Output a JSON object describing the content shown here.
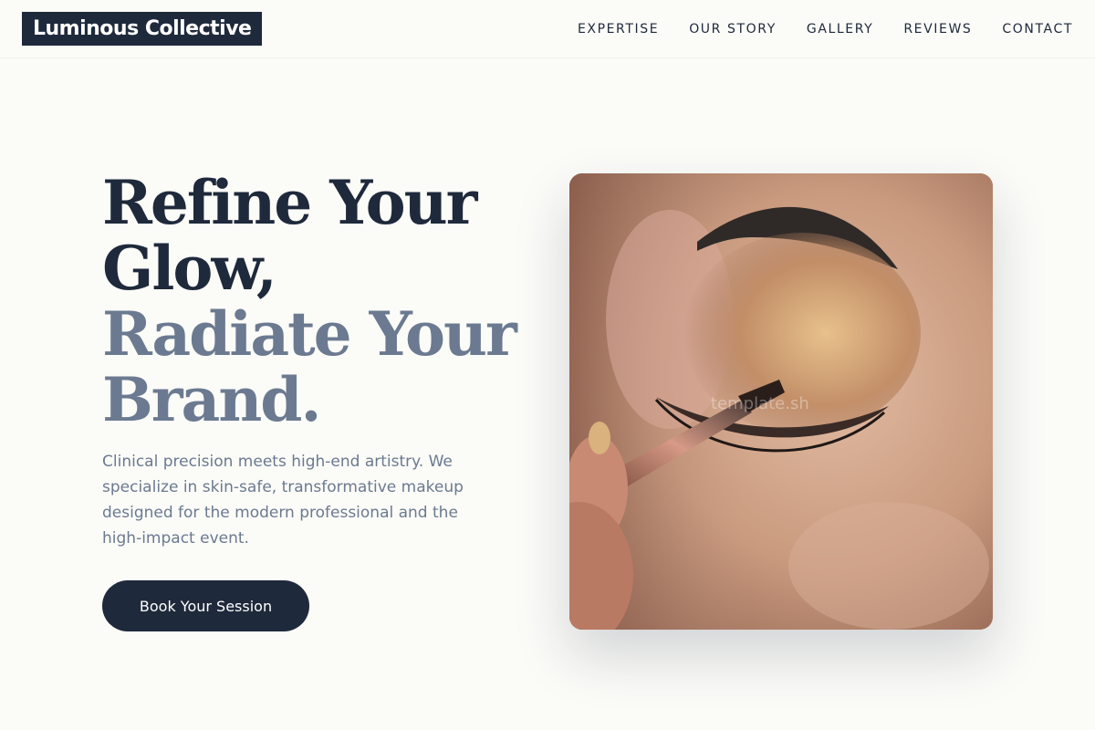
{
  "brand": {
    "name": "Luminous Collective"
  },
  "nav": {
    "items": [
      {
        "label": "EXPERTISE"
      },
      {
        "label": "OUR STORY"
      },
      {
        "label": "GALLERY"
      },
      {
        "label": "REVIEWS"
      },
      {
        "label": "CONTACT"
      }
    ]
  },
  "hero": {
    "headline_line1": "Refine Your",
    "headline_line2": "Glow,",
    "headline_line3": "Radiate Your",
    "headline_line4": "Brand.",
    "description": "Clinical precision meets high-end artistry. We specialize in skin-safe, transformative makeup designed for the modern professional and the high-impact event.",
    "cta_label": "Book Your Session",
    "image_watermark": "template.sh"
  },
  "colors": {
    "primary": "#1e293b",
    "muted": "#6b7a90",
    "background": "#fbfbf8"
  }
}
